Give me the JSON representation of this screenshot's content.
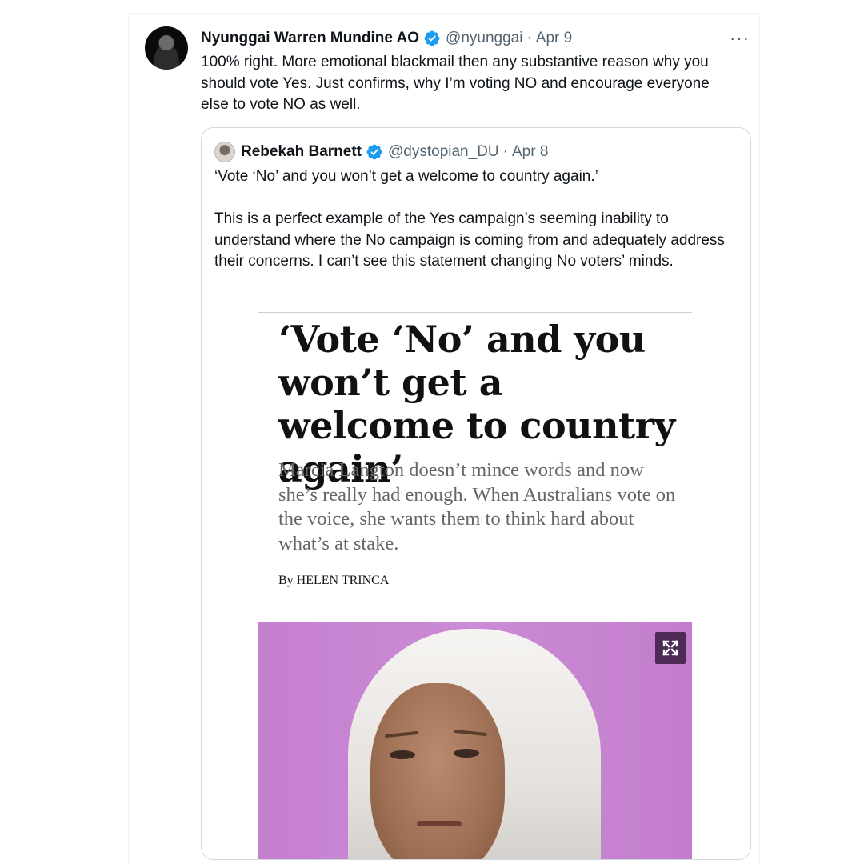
{
  "tweet": {
    "author_name": "Nyunggai Warren Mundine AO",
    "handle": "@nyunggai",
    "separator": "·",
    "date": "Apr 9",
    "more_label": "···",
    "text": "100% right. More emotional blackmail then any substantive reason why you should vote Yes. Just confirms, why I’m voting NO and encourage everyone else to vote NO as well."
  },
  "quoted_tweet": {
    "author_name": "Rebekah Barnett",
    "handle": "@dystopian_DU",
    "separator": "·",
    "date": "Apr 8",
    "paragraph_1": "‘Vote ‘No’ and you won’t get a welcome to country again.’",
    "paragraph_2": "This is a perfect example of the Yes campaign’s seeming inability to understand where the No campaign is coming from and adequately address their concerns. I can’t see this statement changing No voters’ minds.",
    "article": {
      "headline": "‘Vote ‘No’ and you won’t get a welcome to country again’",
      "standfirst": "Marcia Langton doesn’t mince words and now she’s really had enough. When Australians vote on the voice, she wants them to think hard about what’s at stake.",
      "byline": "By HELEN TRINCA"
    }
  },
  "colors": {
    "verified_blue": "#1d9bf0",
    "secondary_text": "#536471",
    "photo_background": "#c884d2",
    "expand_button": "#4e2a57"
  },
  "icons": {
    "verified": "verified-badge-icon",
    "more": "more-horizontal-icon",
    "expand": "expand-icon"
  }
}
